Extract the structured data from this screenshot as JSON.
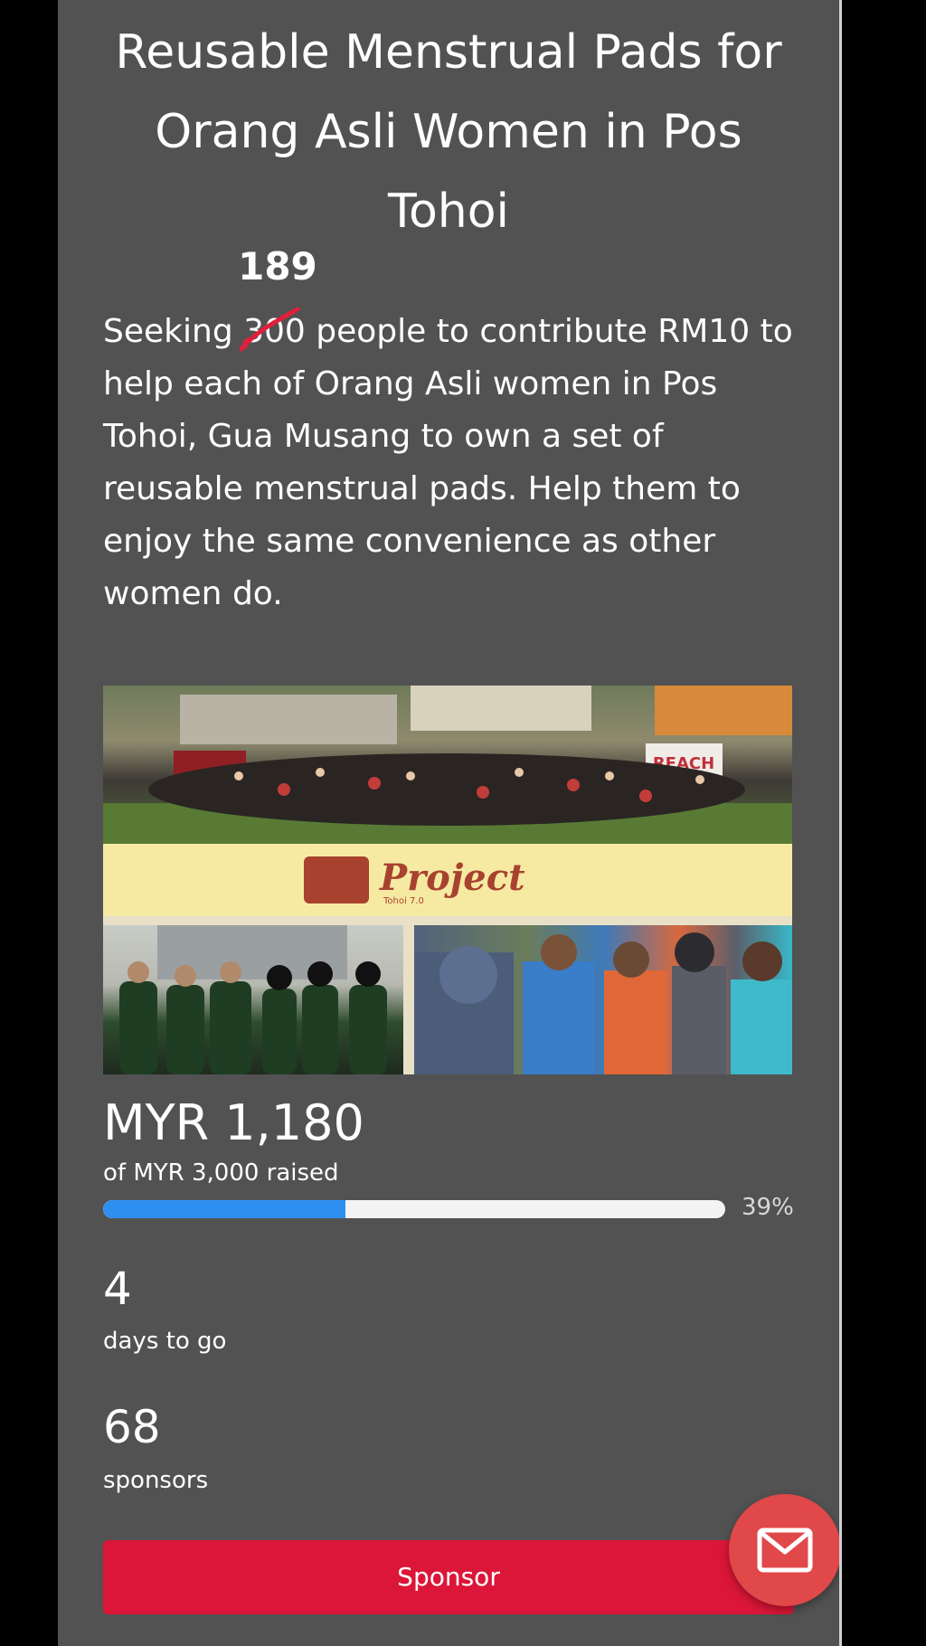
{
  "campaign": {
    "title": "Reusable Menstrual Pads for Orang Asli Women in Pos Tohoi",
    "desc_prefix": "Seeking ",
    "desc_struck_number": "300",
    "desc_handwritten_number": "189",
    "desc_suffix": " people to contribute RM10 to help each of Orang Asli women in Pos Tohoi, Gua Musang to own a set of reusable menstrual pads. Help them to enjoy the same convenience as other women do.",
    "image": {
      "banner_text": "Project",
      "banner_subtext": "Tohoi 7.0",
      "sign_text": "REACH"
    }
  },
  "funding": {
    "amount": "MYR 1,180",
    "goal_label": "of MYR 3,000 raised",
    "progress_percent": 39,
    "progress_label": "39%"
  },
  "stats": {
    "days_value": "4",
    "days_label": "days to go",
    "sponsors_value": "68",
    "sponsors_label": "sponsors"
  },
  "actions": {
    "sponsor_label": "Sponsor",
    "message_icon": "envelope-icon"
  },
  "colors": {
    "page_bg": "#525252",
    "progress_fill": "#2f8ff0",
    "sponsor_button": "#dc1638",
    "fab": "#e0484a"
  }
}
